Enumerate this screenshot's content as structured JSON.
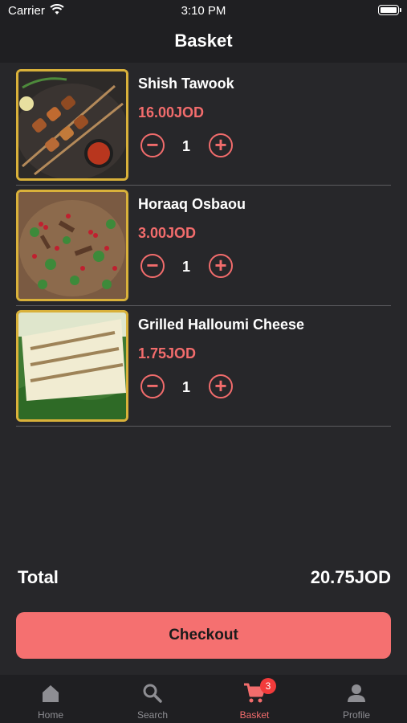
{
  "status": {
    "carrier": "Carrier",
    "time": "3:10 PM"
  },
  "header": {
    "title": "Basket"
  },
  "items": [
    {
      "name": "Shish Tawook",
      "price": "16.00JOD",
      "quantity": "1",
      "image": "shish-tawook-photo"
    },
    {
      "name": "Horaaq Osbaou",
      "price": "3.00JOD",
      "quantity": "1",
      "image": "horaaq-osbaou-photo"
    },
    {
      "name": "Grilled Halloumi Cheese",
      "price": "1.75JOD",
      "quantity": "1",
      "image": "grilled-halloumi-photo"
    }
  ],
  "summary": {
    "total_label": "Total",
    "total_value": "20.75JOD"
  },
  "checkout_label": "Checkout",
  "tabs": [
    {
      "label": "Home",
      "icon": "home-icon",
      "active": false
    },
    {
      "label": "Search",
      "icon": "search-icon",
      "active": false
    },
    {
      "label": "Basket",
      "icon": "cart-icon",
      "active": true,
      "badge": "3"
    },
    {
      "label": "Profile",
      "icon": "profile-icon",
      "active": false
    }
  ],
  "colors": {
    "accent": "#f26c6c",
    "button": "#f57070",
    "background": "#27272a",
    "frame": "#d9b13a",
    "badge": "#f23b3b"
  }
}
